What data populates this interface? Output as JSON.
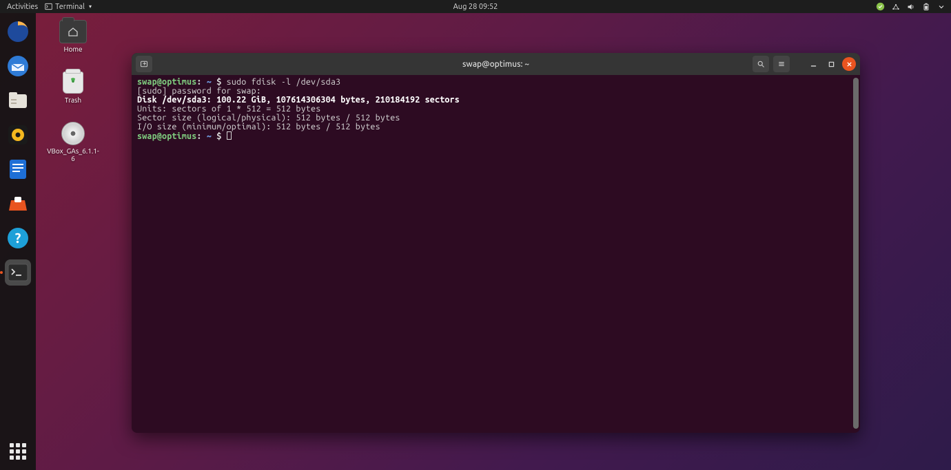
{
  "top_panel": {
    "activities": "Activities",
    "app_name": "Terminal",
    "clock": "Aug 28  09:52"
  },
  "desktop_icons": {
    "home": "Home",
    "trash": "Trash",
    "disc": "VBox_GAs_6.1.1-6"
  },
  "dock": {
    "items": [
      "firefox",
      "thunderbird",
      "files",
      "rhythmbox",
      "writer",
      "software",
      "help",
      "terminal",
      "disc"
    ]
  },
  "terminal": {
    "title": "swap@optimus: ~",
    "prompt_user_host": "swap@optimus",
    "prompt_sep": ": ",
    "prompt_path": "~",
    "prompt_dollar": " $ ",
    "cmd1": "sudo fdisk -l /dev/sda3",
    "out_pw": "[sudo] password for swap: ",
    "out_disk": "Disk /dev/sda3: 100.22 GiB, 107614306304 bytes, 210184192 sectors",
    "out_units": "Units: sectors of 1 * 512 = 512 bytes",
    "out_sector": "Sector size (logical/physical): 512 bytes / 512 bytes",
    "out_io": "I/O size (minimum/optimal): 512 bytes / 512 bytes"
  }
}
